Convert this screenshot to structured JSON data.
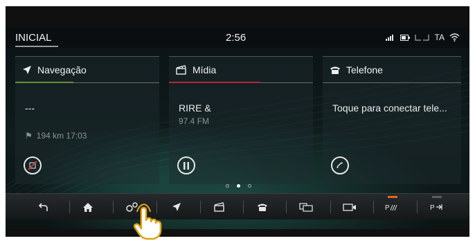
{
  "status_bar": {
    "home_label": "INICIAL",
    "time": "2:56",
    "indicator_text": "TA"
  },
  "cards": {
    "navigation": {
      "title": "Navegação",
      "line1": "---",
      "distance_eta": "194 km 17:03",
      "accent_color": "#6a8f3a"
    },
    "media": {
      "title": "Mídia",
      "station": "RIRE &",
      "frequency": "97.4 FM",
      "accent_color": "#b5283c"
    },
    "phone": {
      "title": "Telefone",
      "message": "Toque para conectar tele..."
    }
  },
  "pager": {
    "pages": 3,
    "active": 2
  },
  "dock": {
    "items": [
      "back-icon",
      "home-icon",
      "settings-icon",
      "navigation-icon",
      "media-icon",
      "phone-icon",
      "apps-icon",
      "camera-icon",
      "park-assist-icon",
      "valet-mode-icon"
    ],
    "flag_color": "#e06a1a"
  }
}
